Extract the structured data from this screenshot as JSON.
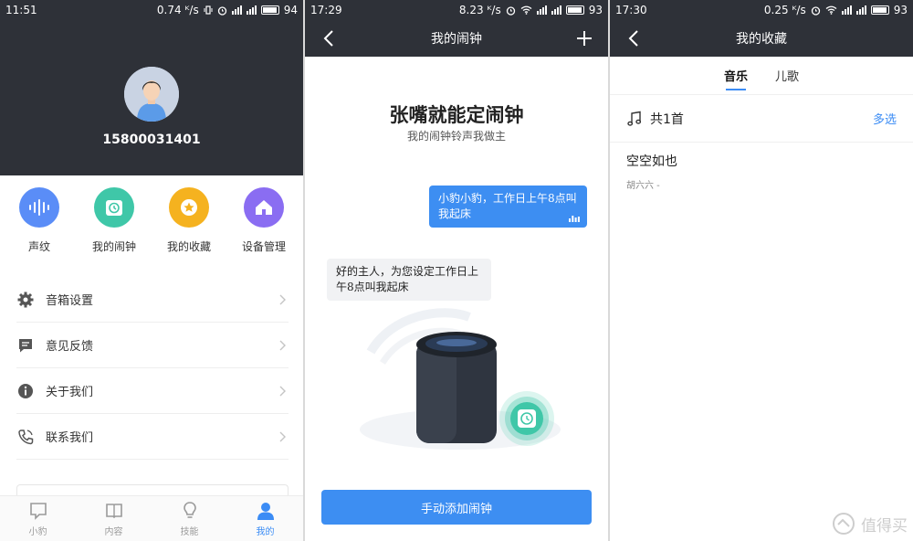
{
  "colors": {
    "dark_header": "#2e3138",
    "accent_blue": "#3d8ef2",
    "voice_blue": "#5a8df7",
    "alarm_teal": "#3fc7a8",
    "favorite_yellow": "#f5b21f",
    "device_purple": "#8a6df2"
  },
  "screen1": {
    "status": {
      "time": "11:51",
      "speed": "0.74 ᴷ/s",
      "battery": "94"
    },
    "profile": {
      "phone_number": "15800031401",
      "avatar_icon": "user-avatar-icon"
    },
    "quick_actions": [
      {
        "label": "声纹",
        "icon": "voiceprint-icon"
      },
      {
        "label": "我的闹钟",
        "icon": "alarm-clock-icon"
      },
      {
        "label": "我的收藏",
        "icon": "star-icon"
      },
      {
        "label": "设备管理",
        "icon": "home-icon"
      }
    ],
    "menu": [
      {
        "label": "音箱设置",
        "icon": "gear-icon"
      },
      {
        "label": "意见反馈",
        "icon": "feedback-icon"
      },
      {
        "label": "关于我们",
        "icon": "info-icon"
      },
      {
        "label": "联系我们",
        "icon": "phone-icon"
      }
    ],
    "tabs": [
      {
        "label": "小豹",
        "icon": "chat-icon"
      },
      {
        "label": "内容",
        "icon": "book-icon"
      },
      {
        "label": "技能",
        "icon": "lightbulb-icon"
      },
      {
        "label": "我的",
        "icon": "person-icon",
        "active": true
      }
    ]
  },
  "screen2": {
    "status": {
      "time": "17:29",
      "speed": "8.23 ᴷ/s",
      "battery": "93"
    },
    "nav_title": "我的闹钟",
    "hero_title": "张嘴就能定闹钟",
    "hero_subtitle": "我的闹钟铃声我做主",
    "user_message": "小豹小豹，工作日上午8点叫我起床",
    "bot_message": "好的主人，为您设定工作日上午8点叫我起床",
    "add_button": "手动添加闹钟"
  },
  "screen3": {
    "status": {
      "time": "17:30",
      "speed": "0.25 ᴷ/s",
      "battery": "93"
    },
    "nav_title": "我的收藏",
    "tabs": [
      {
        "label": "音乐",
        "active": true
      },
      {
        "label": "儿歌",
        "active": false
      }
    ],
    "count_label": "共1首",
    "multi_select": "多选",
    "songs": [
      {
        "title": "空空如也",
        "artist": "胡六六 -"
      }
    ],
    "watermark": "值得买"
  }
}
